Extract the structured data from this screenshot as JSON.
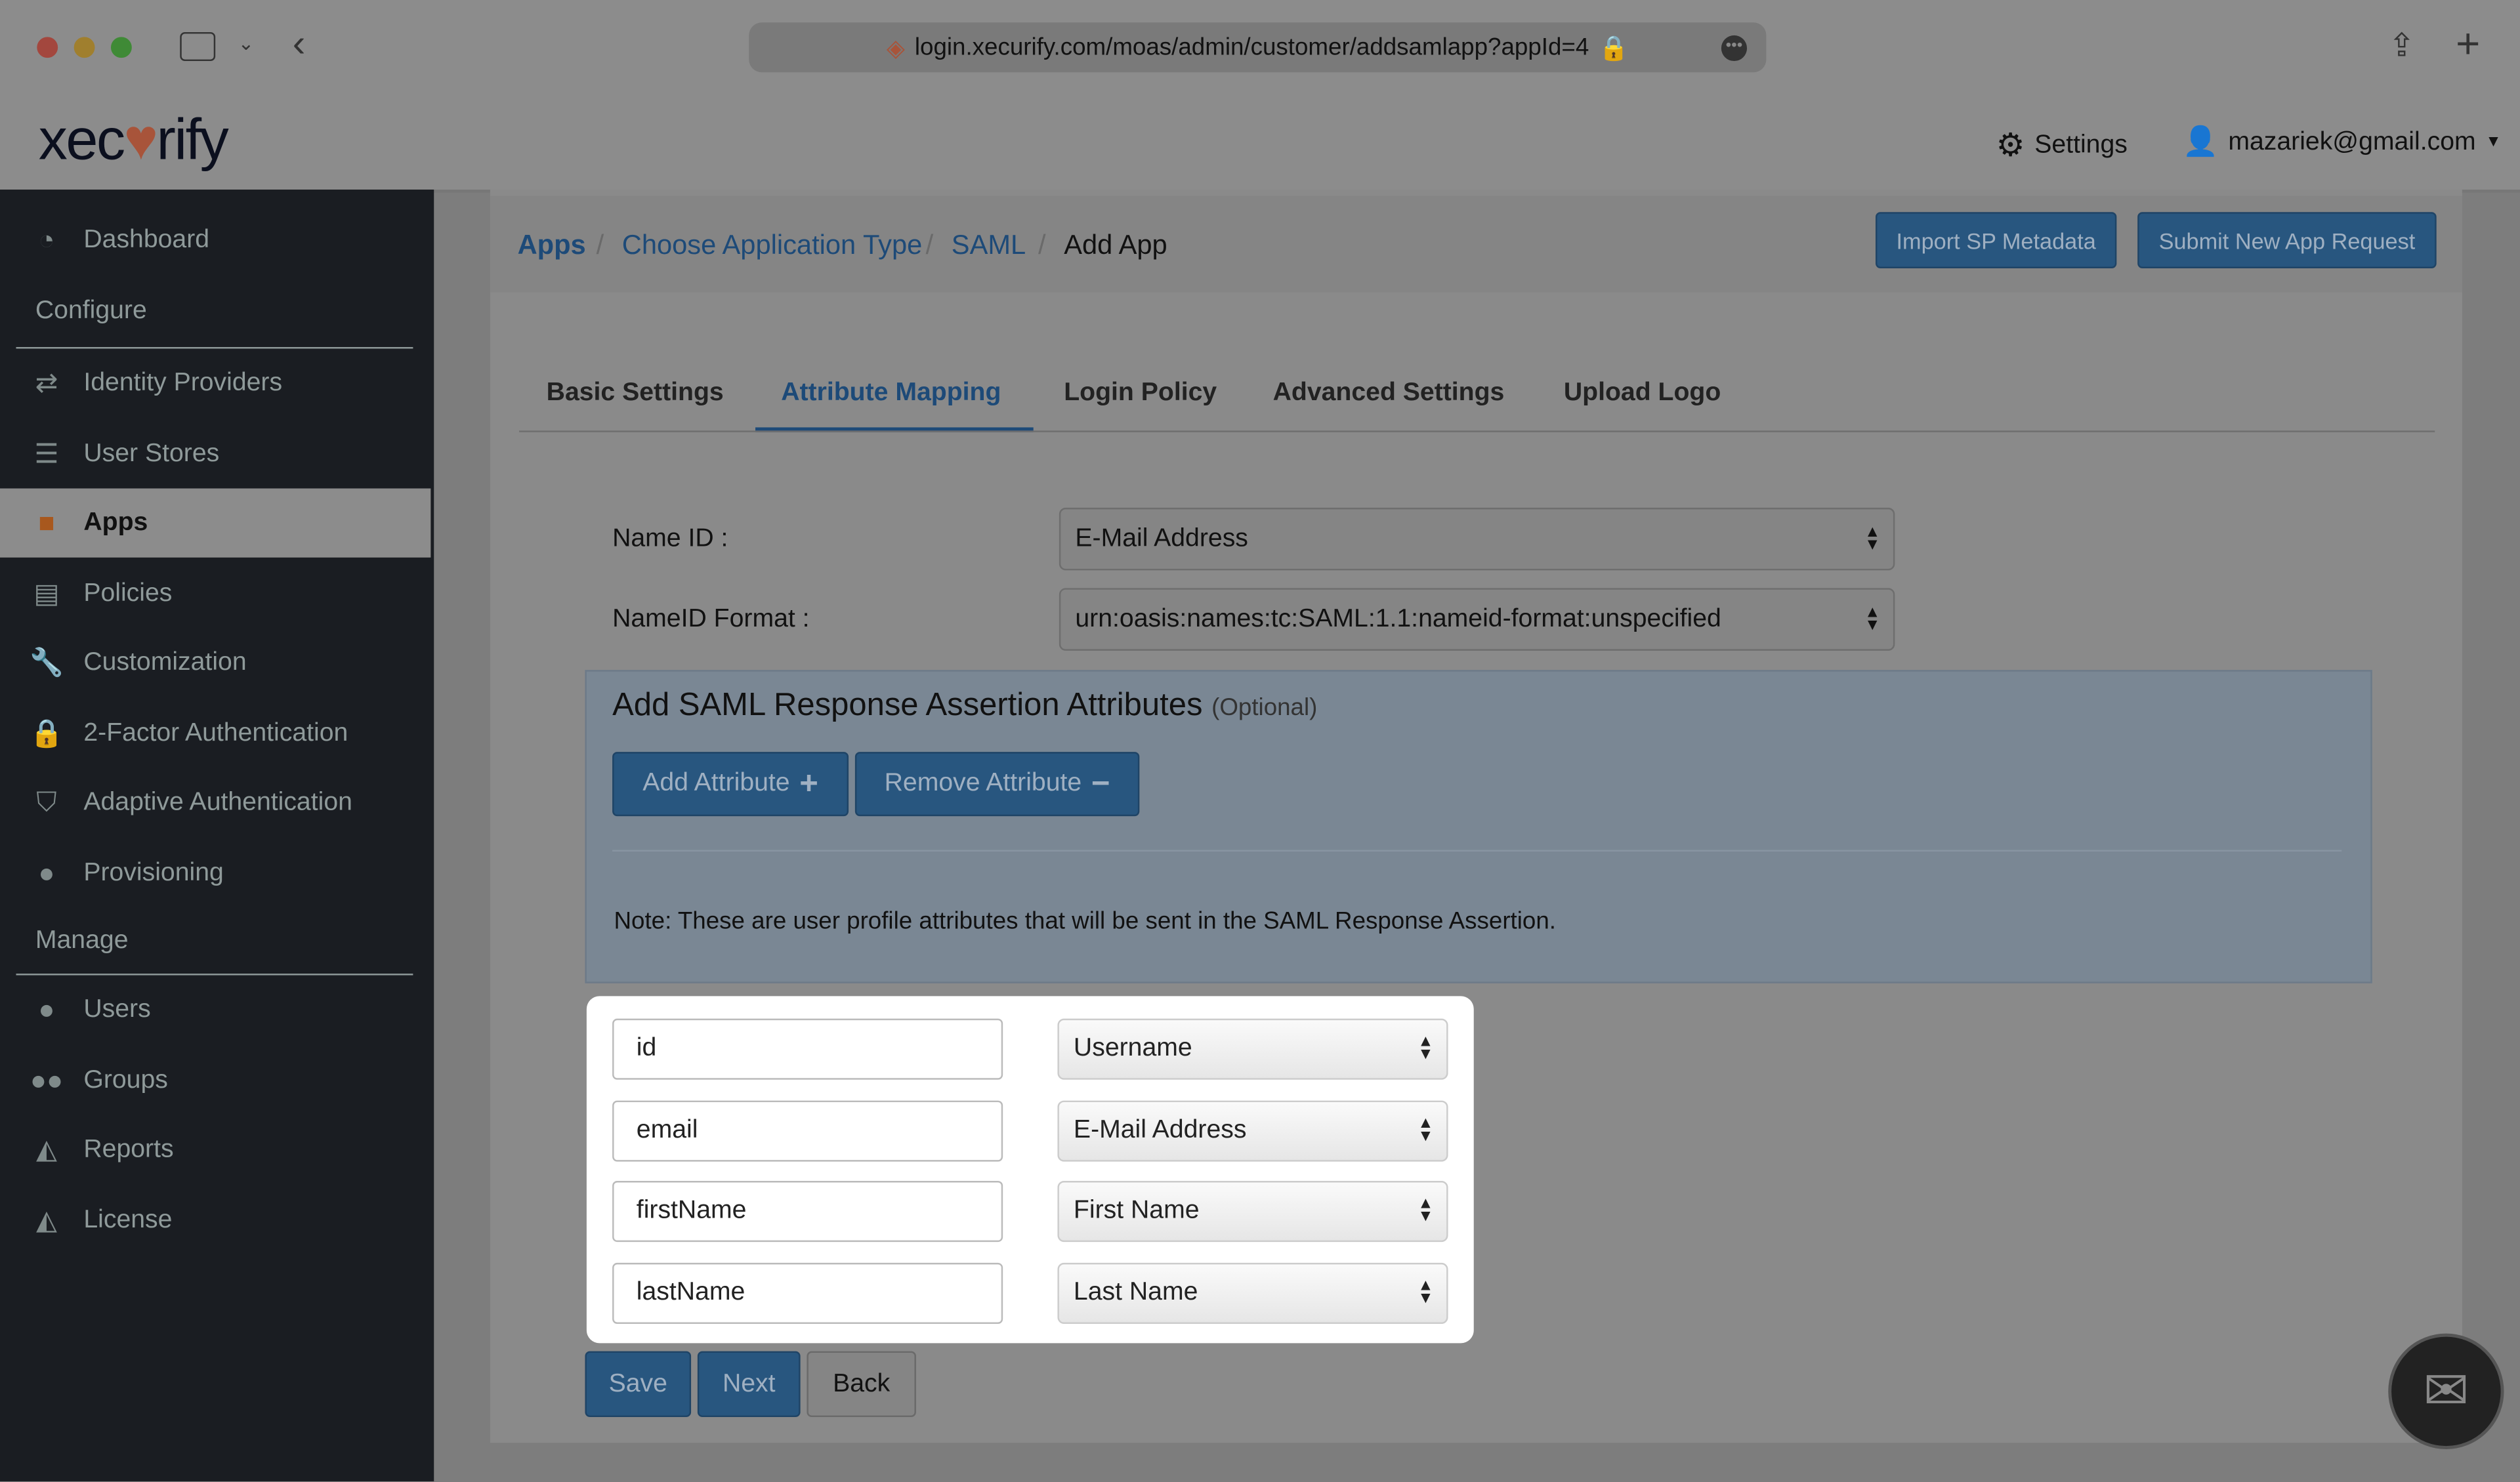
{
  "browser": {
    "url": "login.xecurify.com/moas/admin/customer/addsamlapp?appId=4"
  },
  "header": {
    "logo": "xecurify",
    "settings": "Settings",
    "user": "mazariek@gmail.com"
  },
  "sidebar": {
    "dashboard": "Dashboard",
    "configure": "Configure",
    "manage": "Manage",
    "items": [
      {
        "label": "Identity Providers"
      },
      {
        "label": "User Stores"
      },
      {
        "label": "Apps"
      },
      {
        "label": "Policies"
      },
      {
        "label": "Customization"
      },
      {
        "label": "2-Factor Authentication"
      },
      {
        "label": "Adaptive Authentication"
      },
      {
        "label": "Provisioning"
      }
    ],
    "manage_items": [
      {
        "label": "Users"
      },
      {
        "label": "Groups"
      },
      {
        "label": "Reports"
      },
      {
        "label": "License"
      }
    ]
  },
  "breadcrumb": [
    "Apps",
    "Choose Application Type",
    "SAML",
    "Add App"
  ],
  "actions": {
    "import": "Import SP Metadata",
    "submit": "Submit New App Request"
  },
  "tabs": [
    "Basic Settings",
    "Attribute Mapping",
    "Login Policy",
    "Advanced Settings",
    "Upload Logo"
  ],
  "form": {
    "nameid_label": "Name ID :",
    "nameid_value": "E-Mail Address",
    "format_label": "NameID Format :",
    "format_value": "urn:oasis:names:tc:SAML:1.1:nameid-format:unspecified"
  },
  "panel": {
    "title": "Add SAML Response Assertion Attributes",
    "optional": "(Optional)",
    "add": "Add Attribute",
    "remove": "Remove Attribute",
    "note": "Note: These are user profile attributes that will be sent in the SAML Response Assertion."
  },
  "attributes": [
    {
      "name": "id",
      "value": "Username"
    },
    {
      "name": "email",
      "value": "E-Mail Address"
    },
    {
      "name": "firstName",
      "value": "First Name"
    },
    {
      "name": "lastName",
      "value": "Last Name"
    }
  ],
  "footer": {
    "save": "Save",
    "next": "Next",
    "back": "Back"
  }
}
